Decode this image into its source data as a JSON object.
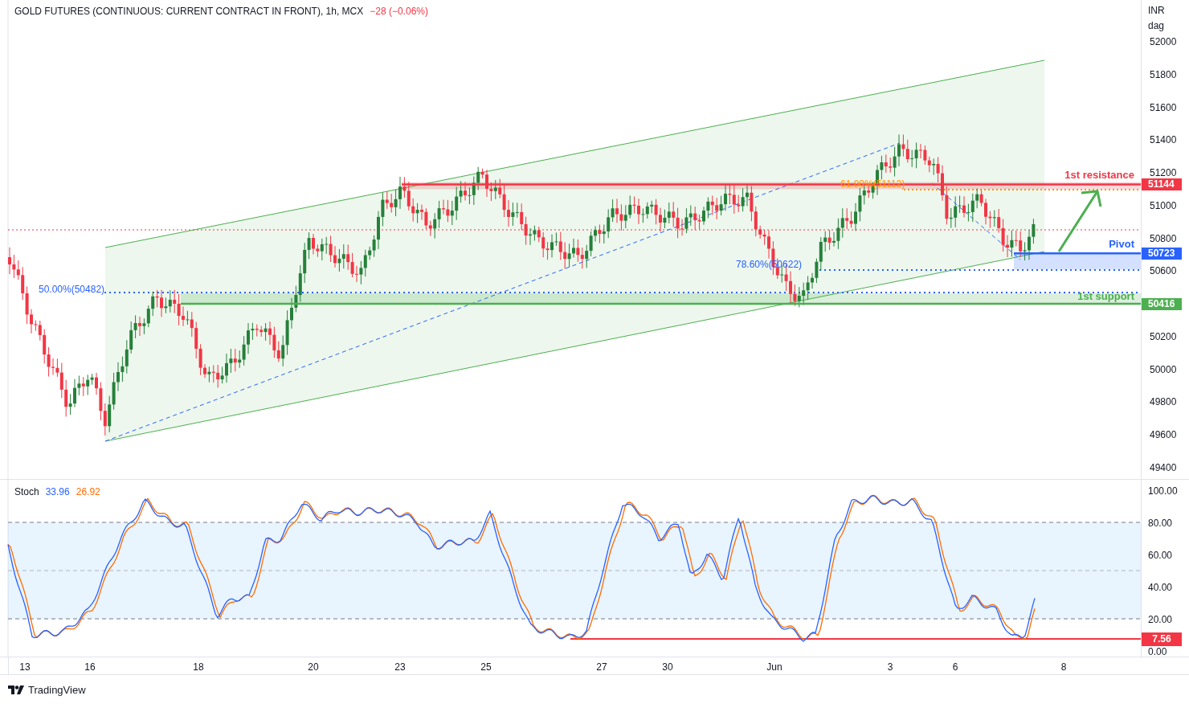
{
  "header": {
    "title": "GOLD FUTURES (CONTINUOUS: CURRENT CONTRACT IN FRONT), 1h, MCX",
    "change": "−28 (−0.06%)"
  },
  "price_axis": {
    "currency": "INR",
    "unit": "dag",
    "ticks": [
      "52000",
      "51800",
      "51600",
      "51400",
      "51200",
      "51000",
      "50800",
      "50600",
      "50200",
      "50000",
      "49800",
      "49600",
      "49400"
    ]
  },
  "levels": [
    {
      "label": "1st resistance",
      "value": "51144",
      "color": "#f23645"
    },
    {
      "label": "Pivot",
      "value": "50723",
      "color": "#2962ff"
    },
    {
      "label": "1st support",
      "value": "50416",
      "color": "#4caf50"
    }
  ],
  "fib_labels": [
    "50.00%(50482)",
    "78.60%(50622)",
    "61.80%(51112)"
  ],
  "stoch": {
    "name": "Stoch",
    "k": "33.96",
    "d": "26.92",
    "ticks": [
      "100.00",
      "80.00",
      "60.00",
      "40.00",
      "20.00",
      "0.00"
    ],
    "badge": "7.56"
  },
  "time_axis": [
    "13",
    "16",
    "18",
    "20",
    "23",
    "25",
    "27",
    "30",
    "Jun",
    "3",
    "6",
    "8"
  ],
  "footer": {
    "brand": "TradingView"
  }
}
